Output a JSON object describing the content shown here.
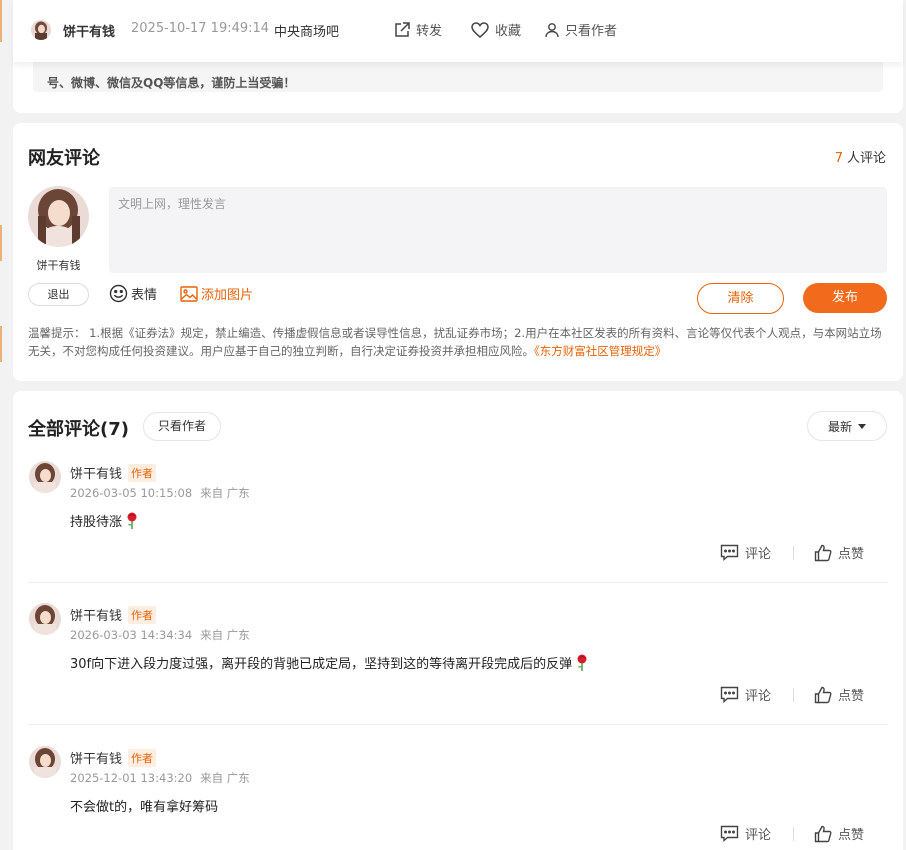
{
  "topbar": {
    "author": "饼干有钱",
    "time": "2025-10-17 19:49:14",
    "bar_name": "中央商场吧",
    "share_label": "转发",
    "favorite_label": "收藏",
    "author_only_label": "只看作者"
  },
  "prev_notice": "号、微博、微信及QQ等信息，谨防上当受骗！",
  "comment_form": {
    "title": "网友评论",
    "count_num": "7",
    "count_suffix": "人评论",
    "user_name": "饼干有钱",
    "placeholder": "文明上网，理性发言",
    "logout_label": "退出",
    "emoji_label": "表情",
    "image_label": "添加图片",
    "clear_label": "清除",
    "publish_label": "发布",
    "tips_text": "温馨提示：  1.根据《证券法》规定，禁止编造、传播虚假信息或者误导性信息，扰乱证券市场；2.用户在本社区发表的所有资料、言论等仅代表个人观点，与本网站立场无关，不对您构成任何投资建议。用户应基于自己的独立判断，自行决定证券投资并承担相应风险。",
    "tips_link": "《东方财富社区管理规定》"
  },
  "comments_section": {
    "title": "全部评论(7)",
    "author_only_label": "只看作者",
    "sort_label": "最新",
    "reply_label": "评论",
    "like_label": "点赞",
    "items": [
      {
        "name": "饼干有钱",
        "badge": "作者",
        "time": "2026-03-05 10:15:08",
        "from": "来自 广东",
        "content": "持股待涨"
      },
      {
        "name": "饼干有钱",
        "badge": "作者",
        "time": "2026-03-03 14:34:34",
        "from": "来自 广东",
        "content": "30f向下进入段力度过强，离开段的背驰已成定局，坚持到这的等待离开段完成后的反弹"
      },
      {
        "name": "饼干有钱",
        "badge": "作者",
        "time": "2025-12-01 13:43:20",
        "from": "来自 广东",
        "content": "不会做t的，唯有拿好筹码"
      }
    ]
  },
  "colors": {
    "accent": "#f26a1b",
    "accent_text": "#e8630a",
    "badge_bg": "#fdeee2"
  },
  "icons": [
    "share-icon",
    "heart-icon",
    "user-icon",
    "smile-icon",
    "image-icon",
    "comment-icon",
    "thumb-up-icon",
    "rose-emoji"
  ]
}
